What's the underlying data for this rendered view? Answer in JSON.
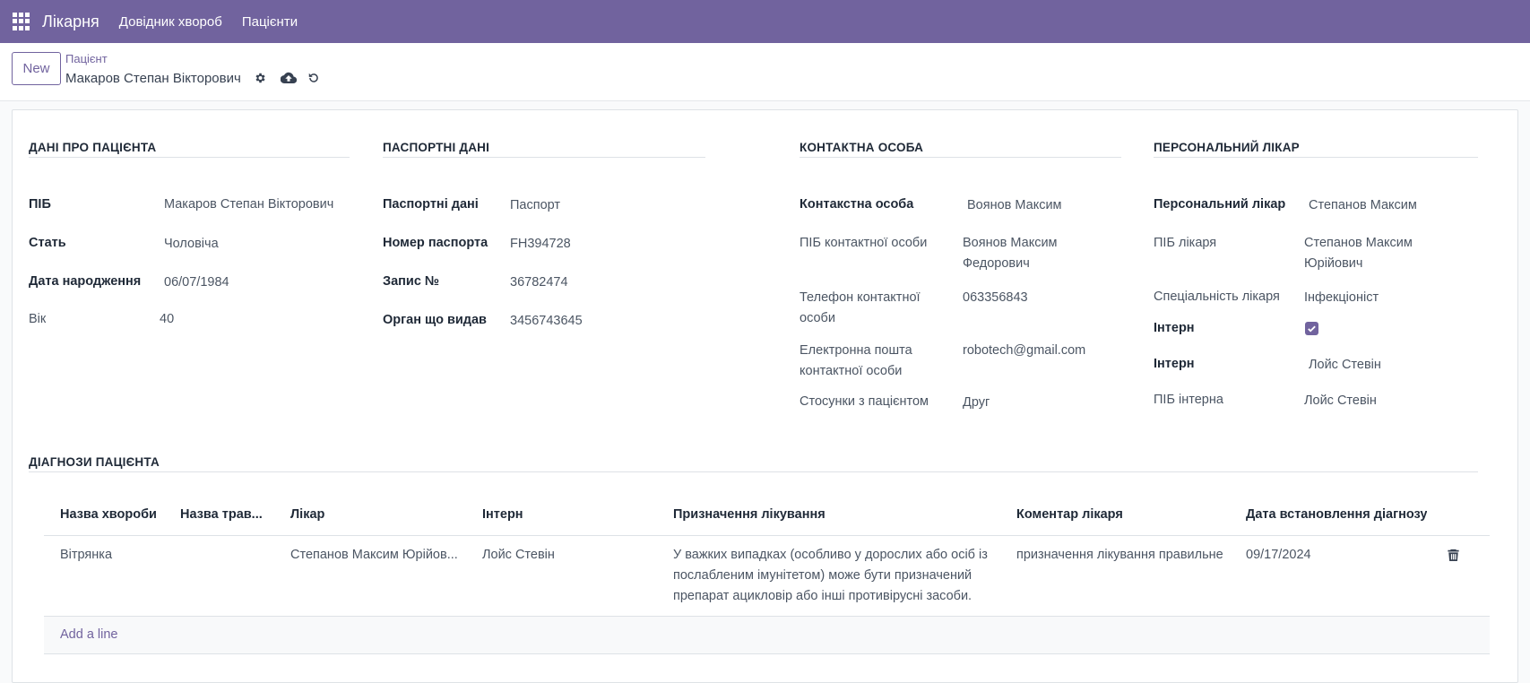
{
  "nav": {
    "app_name": "Лікарня",
    "menu": [
      "Довідник хвороб",
      "Пацієнти"
    ]
  },
  "control": {
    "new_label": "New",
    "breadcrumb_parent": "Пацієнт",
    "breadcrumb_current": "Макаров Степан Вікторович",
    "icons": [
      "gear-icon",
      "cloud-upload-icon",
      "undo-icon"
    ]
  },
  "patient": {
    "title": "ДАНІ ПРО ПАЦІЄНТА",
    "name_label": "ПІБ",
    "name_value": "Макаров Степан Вікторович",
    "gender_label": "Стать",
    "gender_value": "Чоловіча",
    "dob_label": "Дата народження",
    "dob_value": "06/07/1984",
    "age_label": "Вік",
    "age_value": "40"
  },
  "passport": {
    "title": "ПАСПОРТНІ ДАНІ",
    "doc_label": "Паспортні дані",
    "doc_value": "Паспорт",
    "number_label": "Номер паспорта",
    "number_value": "FH394728",
    "record_label": "Запис №",
    "record_value": "36782474",
    "issuer_label": "Орган що видав",
    "issuer_value": "3456743645"
  },
  "contact": {
    "title": "КОНТАКТНА ОСОБА",
    "person_label": "Контакстна особа",
    "person_value": "Воянов Максим",
    "fullname_label": "ПІБ контактної особи",
    "fullname_value_1": "Воянов Максим",
    "fullname_value_2": "Федорович",
    "phone_label_1": "Телефон контактної",
    "phone_label_2": "особи",
    "phone_value": "063356843",
    "email_label_1": "Електронна пошта",
    "email_label_2": "контактної особи",
    "email_value": "robotech@gmail.com",
    "relation_label": "Стосунки з пацієнтом",
    "relation_value": "Друг"
  },
  "doctor": {
    "title": "ПЕРСОНАЛЬНИЙ ЛІКАР",
    "doctor_label": "Персональний лікар",
    "doctor_value": "Степанов Максим",
    "fullname_label": "ПІБ лікаря",
    "fullname_value_1": "Степанов Максим",
    "fullname_value_2": "Юрійович",
    "spec_label": "Спеціальність лікаря",
    "spec_value": "Інфекціоніст",
    "intern_flag_label": "Інтерн",
    "intern_flag_checked": true,
    "intern_label": "Інтерн",
    "intern_value": "Лойс Стевін",
    "intern_fullname_label": "ПІБ інтерна",
    "intern_fullname_value": "Лойс Стевін"
  },
  "diagnoses": {
    "title": "ДІАГНОЗИ ПАЦІЄНТА",
    "columns": [
      "Назва хвороби",
      "Назва трав...",
      "Лікар",
      "Інтерн",
      "Призначення лікування",
      "Коментар лікаря",
      "Дата встановлення діагнозу"
    ],
    "rows": [
      {
        "disease": "Вітрянка",
        "injury": "",
        "doctor": "Степанов Максим Юрійов...",
        "intern": "Лойс Стевін",
        "treatment_1": "У важких випадках (особливо у дорослих або осіб із",
        "treatment_2": "послабленим імунітетом) може бути призначений",
        "treatment_3": "препарат ацикловір або інші противірусні засоби.",
        "comment": "призначення лікування правильне",
        "date": "09/17/2024"
      }
    ],
    "add_line": "Add a line"
  }
}
